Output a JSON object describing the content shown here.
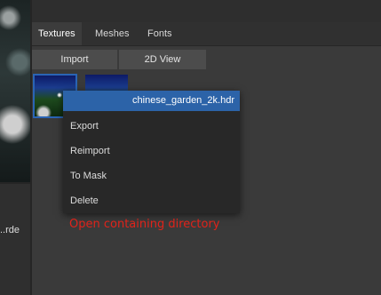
{
  "tabs": [
    {
      "label": "Textures",
      "active": true
    },
    {
      "label": "Meshes",
      "active": false
    },
    {
      "label": "Fonts",
      "active": false
    }
  ],
  "toolbar": {
    "import_label": "Import",
    "view_label": "2D View"
  },
  "left_panel": {
    "item_label": "rde.."
  },
  "context_menu": {
    "title": "chinese_garden_2k.hdr",
    "items": [
      "Export",
      "Reimport",
      "To Mask",
      "Delete"
    ]
  },
  "tooltip": {
    "text": "Open containing directory",
    "color": "#e0231a"
  },
  "colors": {
    "accent": "#2c63a8",
    "selection_border": "#2a64b5"
  }
}
